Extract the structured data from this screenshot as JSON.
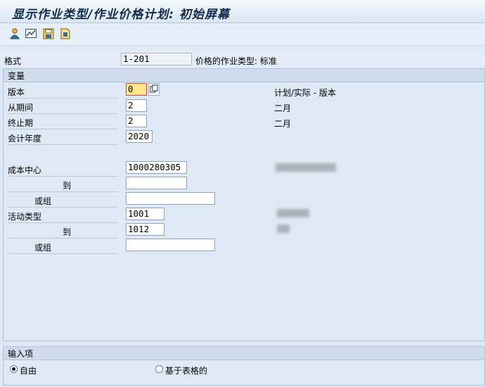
{
  "window": {
    "title": "显示作业类型/作业价格计划: 初始屏幕"
  },
  "toolbar": {
    "icons": [
      "person-icon",
      "chart-icon",
      "save-icon",
      "variant-icon"
    ]
  },
  "header": {
    "format_label": "格式",
    "format_value": "1-201",
    "format_desc": "价格的作业类型: 标准"
  },
  "variables": {
    "title": "变量",
    "version_label": "版本",
    "version_value": "0",
    "version_desc": "计划/实际 - 版本",
    "from_period_label": "从期间",
    "from_period_value": "2",
    "from_period_desc": "二月",
    "to_period_label": "终止期",
    "to_period_value": "2",
    "to_period_desc": "二月",
    "fiscal_year_label": "会计年度",
    "fiscal_year_value": "2020",
    "cost_center_label": "成本中心",
    "cost_center_value": "1000280305",
    "cost_center_to_label": "到",
    "cost_center_to_value": "",
    "cost_center_group_label": "或组",
    "cost_center_group_value": "",
    "activity_type_label": "活动类型",
    "activity_type_value": "1001",
    "activity_type_to_label": "到",
    "activity_type_to_value": "1012",
    "activity_group_label": "或组",
    "activity_group_value": ""
  },
  "input": {
    "title": "输入项",
    "option_free": "自由",
    "option_table": "基于表格的",
    "selected": "free"
  }
}
